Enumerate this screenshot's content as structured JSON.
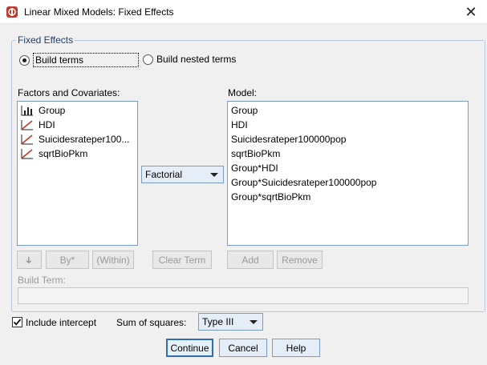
{
  "window": {
    "title": "Linear Mixed Models: Fixed Effects",
    "close_glyph": "✕"
  },
  "fixed_effects": {
    "legend": "Fixed Effects",
    "build_terms": "Build terms",
    "build_nested_terms": "Build nested terms"
  },
  "factors": {
    "label": "Factors and Covariates:",
    "items": [
      {
        "name": "Group",
        "icon": "nominal-bars-icon"
      },
      {
        "name": "HDI",
        "icon": "scale-ruler-icon"
      },
      {
        "name": "Suicidesrateper100...",
        "icon": "scale-ruler-icon"
      },
      {
        "name": "sqrtBioPkm",
        "icon": "scale-ruler-icon"
      }
    ]
  },
  "model": {
    "label": "Model:",
    "items": [
      "Group",
      "HDI",
      "Suicidesrateper100000pop",
      "sqrtBioPkm",
      "Group*HDI",
      "Group*Suicidesrateper100000pop",
      "Group*sqrtBioPkm"
    ]
  },
  "term_combo": {
    "value": "Factorial"
  },
  "buttons": {
    "arrow": "➜",
    "by": "By*",
    "within": "(Within)",
    "clear_term": "Clear Term",
    "add": "Add",
    "remove": "Remove",
    "continue": "Continue",
    "cancel": "Cancel",
    "help": "Help"
  },
  "build_term": {
    "label": "Build Term:",
    "value": ""
  },
  "intercept": {
    "label": "Include intercept",
    "checked": true
  },
  "sum_of_squares": {
    "label": "Sum of squares:",
    "value": "Type III"
  }
}
